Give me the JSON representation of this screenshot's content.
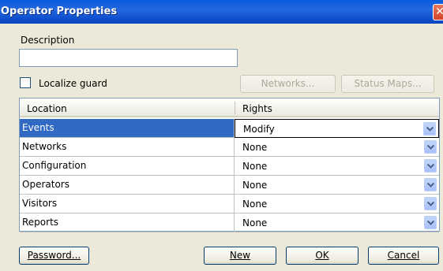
{
  "window": {
    "title": "Operator Properties",
    "close_glyph": "✕"
  },
  "description": {
    "label": "Description",
    "value": "",
    "placeholder": ""
  },
  "localize_guard": {
    "label": "Localize guard",
    "checked": false
  },
  "buttons": {
    "networks": "Networks...",
    "status_maps": "Status Maps...",
    "password": "Password...",
    "new": "New",
    "ok": "OK",
    "cancel": "Cancel"
  },
  "grid": {
    "columns": [
      "Location",
      "Rights"
    ],
    "rows": [
      {
        "location": "Events",
        "rights": "Modify",
        "selected": true
      },
      {
        "location": "Networks",
        "rights": "None"
      },
      {
        "location": "Configuration",
        "rights": "None"
      },
      {
        "location": "Operators",
        "rights": "None"
      },
      {
        "location": "Visitors",
        "rights": "None"
      },
      {
        "location": "Reports",
        "rights": "None"
      }
    ]
  },
  "icons": {
    "close": "close-icon",
    "dropdown": "chevron-down-icon"
  },
  "colors": {
    "titlebar": "#0a5bdc",
    "selection": "#316ac5",
    "dialog_bg": "#ece9d8"
  }
}
